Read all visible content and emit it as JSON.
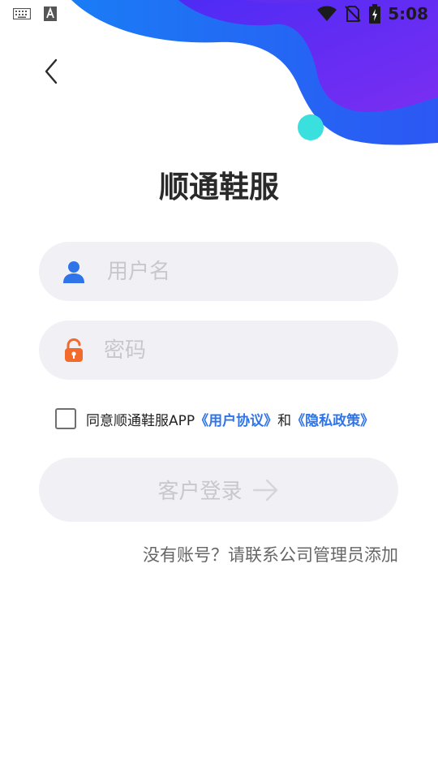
{
  "status_bar": {
    "time": "5:08",
    "left_icons": [
      "keyboard-icon",
      "a-badge-icon"
    ],
    "right_icons": [
      "wifi-icon",
      "no-sim-icon",
      "battery-charging-icon"
    ]
  },
  "header": {
    "back_icon": "chevron-left-icon",
    "title": "顺通鞋服"
  },
  "form": {
    "username": {
      "placeholder": "用户名",
      "value": "",
      "icon": "user-icon"
    },
    "password": {
      "placeholder": "密码",
      "value": "",
      "icon": "unlock-icon"
    },
    "agreement": {
      "checked": false,
      "prefix": "同意顺通鞋服APP",
      "user_agreement": "《用户协议》",
      "conjunction": "和",
      "privacy_policy": "《隐私政策》"
    },
    "login_label": "客户登录",
    "login_icon": "arrow-right-icon"
  },
  "hint": "没有账号？请联系公司管理员添加",
  "colors": {
    "accent_blue": "#2f74e8",
    "wave_purple": "#6a2cf5",
    "wave_blue": "#2a5df2",
    "dot_cyan": "#39e0de",
    "lock_orange": "#f26b2c",
    "field_bg": "#f1f1f5"
  }
}
